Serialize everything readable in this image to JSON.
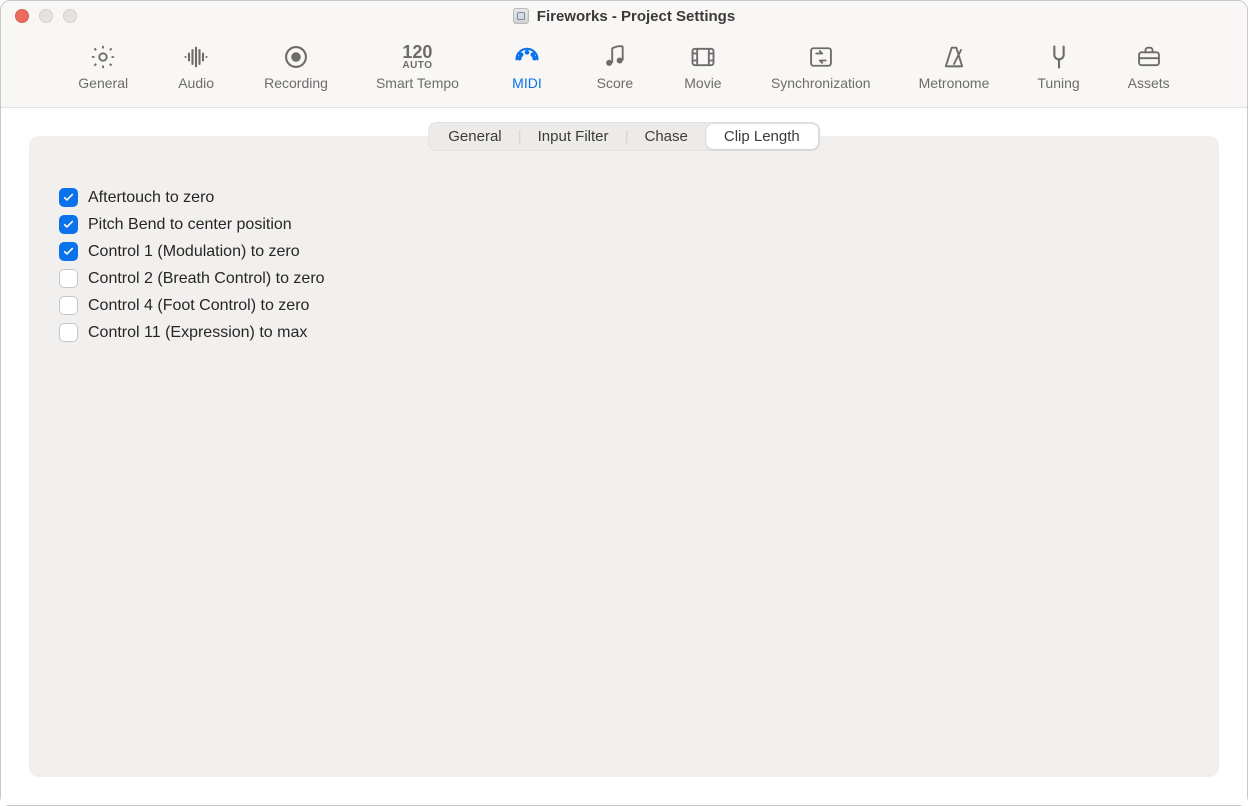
{
  "window": {
    "title": "Fireworks - Project Settings"
  },
  "toolbar": {
    "items": [
      {
        "label": "General",
        "active": false
      },
      {
        "label": "Audio",
        "active": false
      },
      {
        "label": "Recording",
        "active": false
      },
      {
        "label": "Smart Tempo",
        "active": false,
        "tempo_value": "120",
        "tempo_mode": "AUTO"
      },
      {
        "label": "MIDI",
        "active": true
      },
      {
        "label": "Score",
        "active": false
      },
      {
        "label": "Movie",
        "active": false
      },
      {
        "label": "Synchronization",
        "active": false
      },
      {
        "label": "Metronome",
        "active": false
      },
      {
        "label": "Tuning",
        "active": false
      },
      {
        "label": "Assets",
        "active": false
      }
    ]
  },
  "segmented": {
    "items": [
      {
        "label": "General",
        "active": false
      },
      {
        "label": "Input Filter",
        "active": false
      },
      {
        "label": "Chase",
        "active": false
      },
      {
        "label": "Clip Length",
        "active": true
      }
    ]
  },
  "options": [
    {
      "label": "Aftertouch to zero",
      "checked": true
    },
    {
      "label": "Pitch Bend to center position",
      "checked": true
    },
    {
      "label": "Control 1 (Modulation) to zero",
      "checked": true
    },
    {
      "label": "Control 2 (Breath Control) to zero",
      "checked": false
    },
    {
      "label": "Control 4 (Foot Control) to zero",
      "checked": false
    },
    {
      "label": "Control 11 (Expression) to max",
      "checked": false
    }
  ]
}
